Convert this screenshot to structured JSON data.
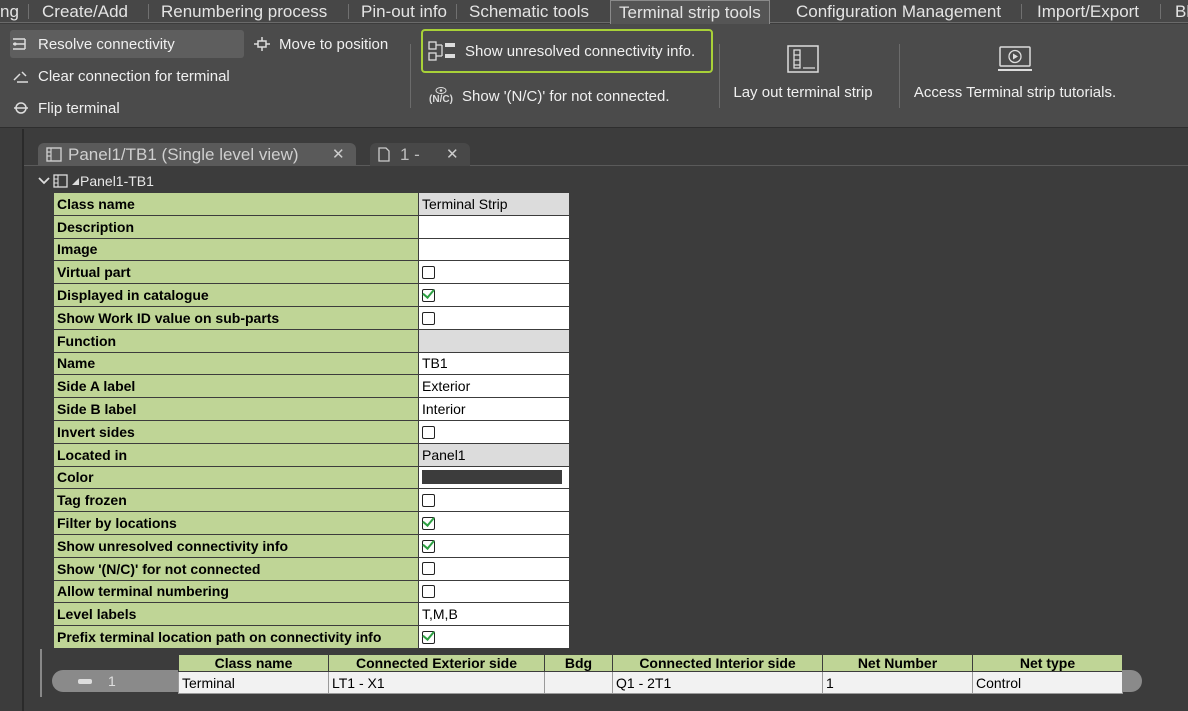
{
  "ribbon_tabs": [
    "ng",
    "Create/Add",
    "Renumbering process",
    "Pin-out info",
    "Schematic tools",
    "Terminal strip tools",
    "Configuration Management",
    "Import/Export",
    "Bl"
  ],
  "ribbon": {
    "resolve": "Resolve connectivity",
    "move": "Move to position",
    "clear": "Clear connection for terminal",
    "flip": "Flip terminal",
    "show_unresolved": "Show unresolved connectivity info.",
    "nc_glyph": "(N/C)",
    "show_nc": "Show '(N/C)' for not connected.",
    "layout": "Lay out terminal strip",
    "tutorials": "Access Terminal strip tutorials."
  },
  "doc_tabs": [
    "Panel1/TB1 (Single level view)",
    "1 -"
  ],
  "tree_node": "Panel1-TB1",
  "properties": [
    {
      "label": "Class name",
      "value": "Terminal Strip",
      "kind": "text",
      "grey": true
    },
    {
      "label": "Description",
      "value": "",
      "kind": "text"
    },
    {
      "label": "Image",
      "value": "",
      "kind": "text"
    },
    {
      "label": "Virtual part",
      "checked": false,
      "kind": "check"
    },
    {
      "label": "Displayed in catalogue",
      "checked": true,
      "kind": "check"
    },
    {
      "label": "Show Work ID value on sub-parts",
      "checked": false,
      "kind": "check"
    },
    {
      "label": "Function",
      "value": "",
      "kind": "text",
      "grey": true
    },
    {
      "label": "Name",
      "value": "TB1",
      "kind": "text"
    },
    {
      "label": "Side A label",
      "value": "Exterior",
      "kind": "text"
    },
    {
      "label": "Side B label",
      "value": "Interior",
      "kind": "text"
    },
    {
      "label": "Invert sides",
      "checked": false,
      "kind": "check"
    },
    {
      "label": "Located in",
      "value": "Panel1",
      "kind": "text",
      "grey": true
    },
    {
      "label": "Color",
      "color": "#3c3c3c",
      "kind": "color"
    },
    {
      "label": "Tag frozen",
      "checked": false,
      "kind": "check"
    },
    {
      "label": "Filter by locations",
      "checked": true,
      "kind": "check"
    },
    {
      "label": "Show unresolved connectivity info",
      "checked": true,
      "kind": "check"
    },
    {
      "label": "Show '(N/C)' for not connected",
      "checked": false,
      "kind": "check"
    },
    {
      "label": "Allow terminal numbering",
      "checked": false,
      "kind": "check"
    },
    {
      "label": "Level labels",
      "value": "T,M,B",
      "kind": "text"
    },
    {
      "label": "Prefix terminal location path on connectivity info",
      "checked": true,
      "kind": "check"
    }
  ],
  "terminal_table": {
    "row_index": "1",
    "columns": [
      "Class name",
      "Connected Exterior side",
      "Bdg",
      "Connected Interior side",
      "Net Number",
      "Net type"
    ],
    "rows": [
      [
        "Terminal",
        "LT1 - X1",
        "",
        "Q1 - 2T1",
        "1",
        "Control"
      ]
    ]
  },
  "colors": {
    "accent_highlight": "#a8d138",
    "grid_label_bg": "#bfd596"
  }
}
